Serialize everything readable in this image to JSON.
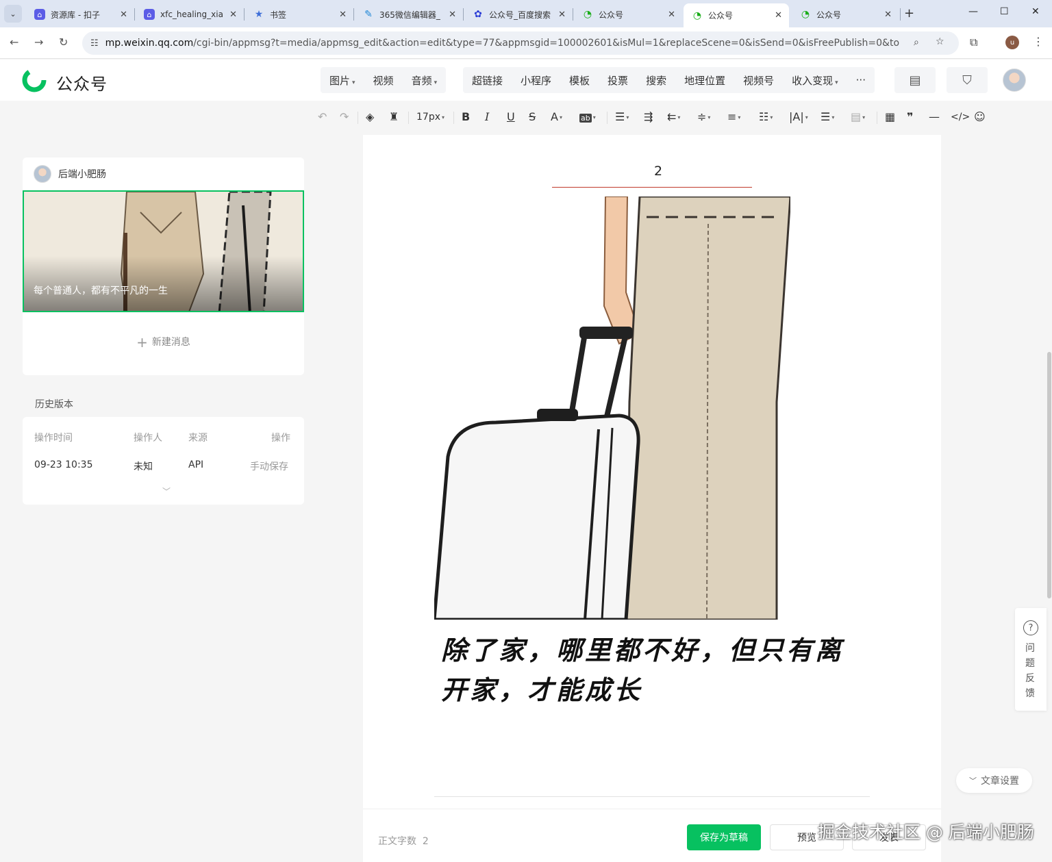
{
  "tabs": [
    {
      "title": "资源库 - 扣子",
      "icon": "coze-icon"
    },
    {
      "title": "xfc_healing_xia",
      "icon": "coze-icon"
    },
    {
      "title": "书签",
      "icon": "bookmark-star-icon"
    },
    {
      "title": "365微信编辑器_",
      "icon": "editor-icon"
    },
    {
      "title": "公众号_百度搜索",
      "icon": "baidu-icon"
    },
    {
      "title": "公众号",
      "icon": "wechat-mp-icon"
    },
    {
      "title": "公众号",
      "icon": "wechat-mp-icon",
      "active": true
    },
    {
      "title": "公众号",
      "icon": "wechat-mp-icon"
    }
  ],
  "address": {
    "host": "mp.weixin.qq.com",
    "path": "/cgi-bin/appmsg?t=media/appmsg_edit&action=edit&type=77&appmsgid=100002601&isMul=1&replaceScene=0&isSend=0&isFreePublish=0&token=..."
  },
  "profile_initial": "u",
  "app": {
    "brand": "公众号",
    "brand_color": "#07c160"
  },
  "insert_menu": {
    "group1": [
      "图片",
      "视频",
      "音频"
    ],
    "group2": [
      "超链接",
      "小程序",
      "模板",
      "投票",
      "搜索",
      "地理位置",
      "视频号",
      "收入变现"
    ],
    "more": "···"
  },
  "toolbar": {
    "font_size": "17px"
  },
  "left": {
    "account_name": "后端小肥肠",
    "cover_title": "每个普通人，都有不平凡的一生",
    "new_message": "新建消息",
    "history_label": "历史版本",
    "history_headers": [
      "操作时间",
      "操作人",
      "来源",
      "操作"
    ],
    "history_rows": [
      {
        "time": "09-23 10:35",
        "operator": "未知",
        "source": "API",
        "action": "手动保存"
      }
    ]
  },
  "editor": {
    "section_number": "2",
    "quote": "除了家，哪里都不好，但只有离开家，才能成长",
    "word_count_label": "正文字数",
    "word_count": "2",
    "save_draft": "保存为草稿",
    "preview": "预览",
    "publish": "发表"
  },
  "right": {
    "feedback": "问题反馈",
    "article_settings": "文章设置"
  },
  "watermark": "掘金技术社区 @ 后端小肥肠"
}
